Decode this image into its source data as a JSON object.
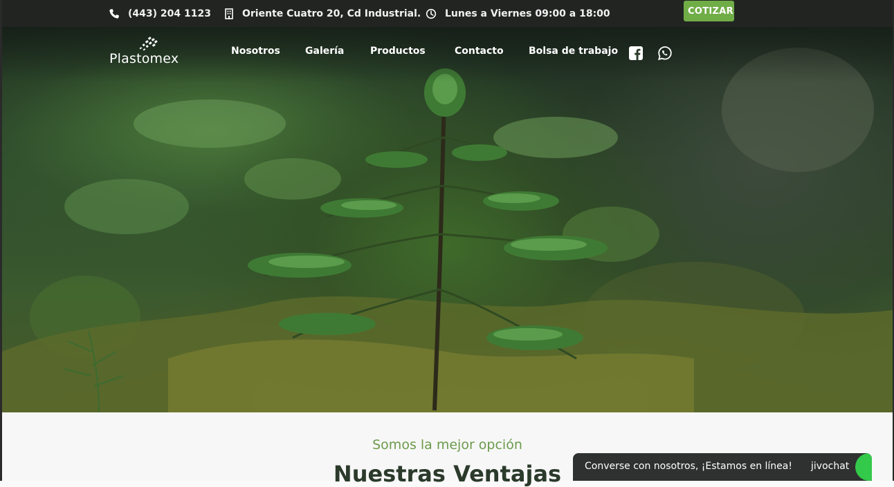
{
  "topbar": {
    "phone": "(443) 204 1123",
    "address": "Oriente Cuatro 20, Cd Industrial.",
    "hours": "Lunes a Viernes 09:00 a 18:00",
    "cta_label": "COTIZAR"
  },
  "brand": {
    "logo_text": "Plastomex"
  },
  "nav": {
    "items": [
      {
        "label": "Nosotros"
      },
      {
        "label": "Galería"
      },
      {
        "label": "Productos"
      },
      {
        "label": "Contacto"
      },
      {
        "label": "Bolsa de trabajo"
      }
    ],
    "social": [
      "facebook-icon",
      "whatsapp-icon"
    ]
  },
  "section": {
    "subtitle": "Somos la mejor opción",
    "title": "Nuestras Ventajas"
  },
  "chat": {
    "message": "Converse con nosotros, ¡Estamos en línea!",
    "brand": "jivochat"
  },
  "colors": {
    "accent_green": "#70ad47",
    "topbar_bg": "#222422",
    "subtitle_green": "#6b9a4a",
    "chat_bg": "#2f3130"
  }
}
